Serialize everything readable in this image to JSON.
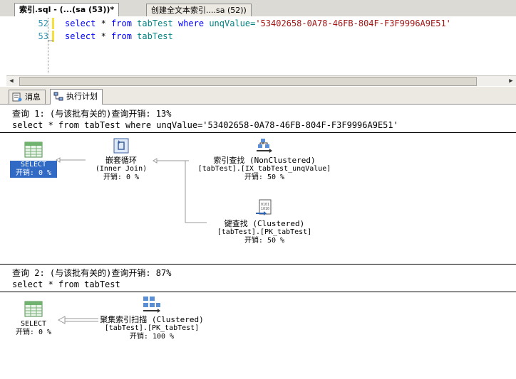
{
  "tabs": [
    {
      "label": "索引.sql - (...(sa (53))*",
      "active": true
    },
    {
      "label": "创建全文本索引....sa (52))",
      "active": false
    }
  ],
  "editor": {
    "lines": [
      {
        "num": "52",
        "kw1": "select",
        "rest1": " * ",
        "kw2": "from",
        "rest2": " tabTest ",
        "kw3": "where",
        "rest3": " unqValue=",
        "str": "'53402658-0A78-46FB-804F-F3F9996A9E51'"
      },
      {
        "num": "53",
        "kw1": "select",
        "rest1": " * ",
        "kw2": "from",
        "rest2": " tabTest"
      }
    ]
  },
  "result_tabs": [
    {
      "label": "消息",
      "active": false
    },
    {
      "label": "执行计划",
      "active": true
    }
  ],
  "queries": [
    {
      "title": "查询 1: (与该批有关的)查询开销: 13%",
      "sql": "select * from tabTest where unqValue='53402658-0A78-46FB-804F-F3F9996A9E51'",
      "select_node": {
        "label": "SELECT",
        "cost": "开销: 0 %"
      },
      "nested_loop": {
        "name": "嵌套循环",
        "sub": "(Inner Join)",
        "cost": "开销: 0 %"
      },
      "index_seek": {
        "name": "索引查找 (NonClustered)",
        "obj": "[tabTest].[IX_tabTest_unqValue]",
        "cost": "开销: 50 %"
      },
      "key_lookup": {
        "name": "键查找 (Clustered)",
        "obj": "[tabTest].[PK_tabTest]",
        "cost": "开销: 50 %"
      }
    },
    {
      "title": "查询 2: (与该批有关的)查询开销: 87%",
      "sql": "select * from tabTest",
      "select_node": {
        "label": "SELECT",
        "cost": "开销: 0 %"
      },
      "scan": {
        "name": "聚集索引扫描 (Clustered)",
        "obj": "[tabTest].[PK_tabTest]",
        "cost": "开销: 100 %"
      }
    }
  ],
  "colors": {
    "selection": "#316ac5",
    "keyword": "#0000ff",
    "string": "#a31515",
    "line_number": "#2b91af"
  }
}
